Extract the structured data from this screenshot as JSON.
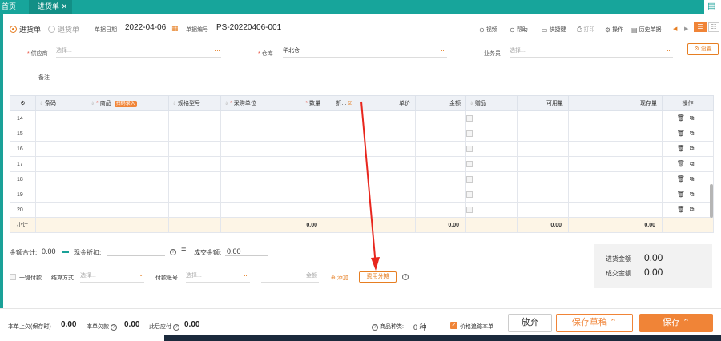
{
  "tabs": {
    "home": "首页",
    "active": "进货单",
    "close": "✕"
  },
  "header": {
    "radio_purchase": "进货单",
    "radio_return": "退货单",
    "date_label": "单据日期",
    "date_value": "2022-04-06",
    "docno_label": "单据编号",
    "docno_value": "PS-20220406-001",
    "tools": {
      "video": "视频",
      "help": "帮助",
      "shortcut": "快捷键",
      "print": "打印",
      "operate": "操作",
      "history": "历史单据"
    }
  },
  "form": {
    "supplier_label": "供应商",
    "supplier_placeholder": "选择...",
    "warehouse_label": "仓库",
    "warehouse_value": "华北仓",
    "staff_label": "业务员",
    "staff_placeholder": "选择...",
    "settings_label": "设置",
    "remark_label": "备注"
  },
  "table": {
    "headers": [
      "条码",
      "商品",
      "规格型号",
      "采购单位",
      "数量",
      "折...",
      "单价",
      "金额",
      "赠品",
      "可用量",
      "现存量",
      "操作"
    ],
    "scan_tag": "扫码录入",
    "rows": [
      "14",
      "15",
      "16",
      "17",
      "18",
      "19",
      "20"
    ],
    "subtotal_label": "小计",
    "subtotals": {
      "qty": "0.00",
      "amount": "0.00",
      "available": "0.00",
      "stock": "0.00"
    }
  },
  "totals": {
    "sum_label": "金额合计:",
    "sum_value": "0.00",
    "cash_discount_label": "现金折扣:",
    "deal_label": "成交金额:",
    "deal_value": "0.00",
    "one_click_pay": "一键付款",
    "settle_label": "结算方式",
    "settle_placeholder": "选择...",
    "account_label": "付款账号",
    "account_placeholder": "选择...",
    "amount_label": "金额",
    "add_label": "添加",
    "share_label": "费用分摊",
    "side_purchase_label": "进货金额",
    "side_purchase_value": "0.00",
    "side_deal_label": "成交金额",
    "side_deal_value": "0.00"
  },
  "bottom": {
    "prev_debt_label": "本单上欠(保存时)",
    "prev_debt_value": "0.00",
    "debt_label": "本单欠款",
    "debt_value": "0.00",
    "payable_label": "此后应付",
    "payable_value": "0.00",
    "kinds_label": "商品种类:",
    "kinds_value": "0",
    "kinds_unit": "种",
    "price_trace": "价格追踪本单",
    "cancel": "放弃",
    "draft": "保存草稿",
    "save": "保存"
  }
}
